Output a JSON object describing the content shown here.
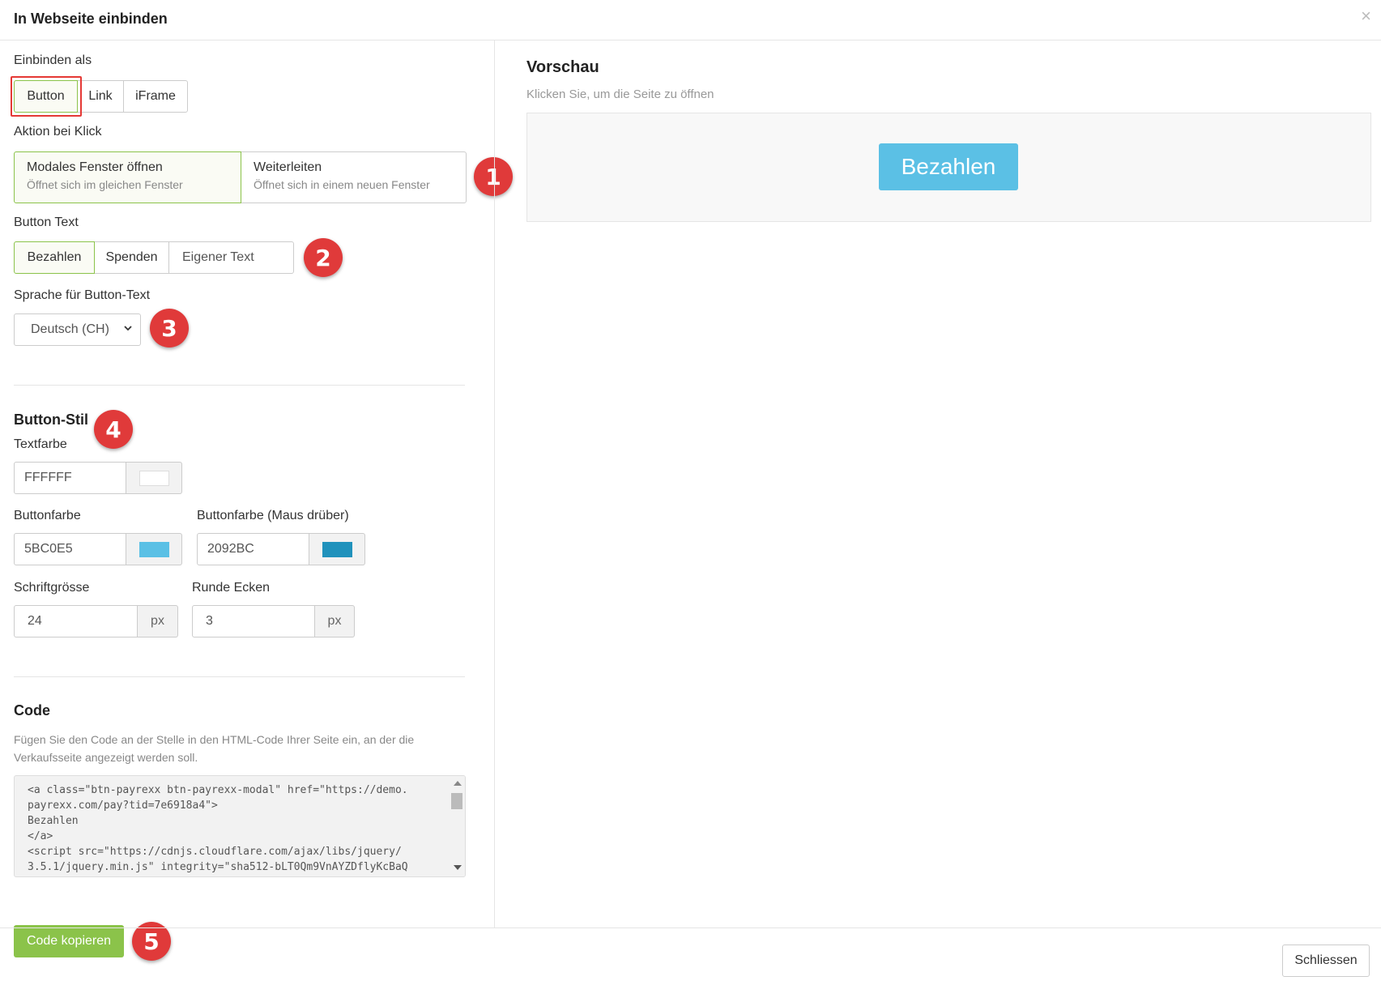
{
  "dialog": {
    "title": "In Webseite einbinden",
    "close_symbol": "×"
  },
  "embed": {
    "label": "Einbinden als",
    "options": [
      "Button",
      "Link",
      "iFrame"
    ],
    "selected": "Button"
  },
  "action": {
    "label": "Aktion bei Klick",
    "options": [
      {
        "title": "Modales Fenster öffnen",
        "subtitle": "Öffnet sich im gleichen Fenster"
      },
      {
        "title": "Weiterleiten",
        "subtitle": "Öffnet sich in einem neuen Fenster"
      }
    ],
    "selected": "Modales Fenster öffnen"
  },
  "button_text": {
    "label": "Button Text",
    "options": [
      "Bezahlen",
      "Spenden",
      "Eigener Text"
    ],
    "selected": "Bezahlen"
  },
  "language": {
    "label": "Sprache für Button-Text",
    "selected": "Deutsch (CH)"
  },
  "button_style": {
    "title": "Button-Stil",
    "text_color": {
      "label": "Textfarbe",
      "value": "FFFFFF",
      "swatch": "#FFFFFF"
    },
    "button_color": {
      "label": "Buttonfarbe",
      "value": "5BC0E5",
      "swatch": "#5BC0E5"
    },
    "hover_color": {
      "label": "Buttonfarbe (Maus drüber)",
      "value": "2092BC",
      "swatch": "#2092BC"
    },
    "font_size": {
      "label": "Schriftgrösse",
      "value": "24",
      "unit": "px"
    },
    "radius": {
      "label": "Runde Ecken",
      "value": "3",
      "unit": "px"
    }
  },
  "code": {
    "title": "Code",
    "help": "Fügen Sie den Code an der Stelle in den HTML-Code Ihrer Seite ein, an der die Verkaufsseite angezeigt werden soll.",
    "content": "<a class=\"btn-payrexx btn-payrexx-modal\" href=\"https://demo.\npayrexx.com/pay?tid=7e6918a4\">\nBezahlen\n</a>\n<script src=\"https://cdnjs.cloudflare.com/ajax/libs/jquery/\n3.5.1/jquery.min.js\" integrity=\"sha512-bLT0Qm9VnAYZDflyKcBaQ",
    "copy_label": "Code kopieren"
  },
  "preview": {
    "title": "Vorschau",
    "subtitle": "Klicken Sie, um die Seite zu öffnen",
    "button_label": "Bezahlen"
  },
  "annotations": [
    "1",
    "2",
    "3",
    "4",
    "5"
  ],
  "footer": {
    "close_label": "Schliessen"
  },
  "colors": {
    "accent": "#8BC34A",
    "badge": "#E03A3A",
    "preview_button": "#5BC0E5",
    "preview_text": "#FFFFFF"
  },
  "icons": {
    "close": "close-icon",
    "dropdown": "chevron-down-icon"
  }
}
